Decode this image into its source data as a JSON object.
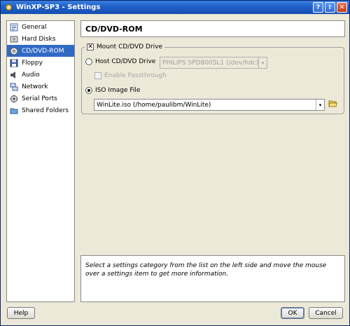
{
  "window": {
    "title": "WinXP-SP3 - Settings",
    "buttons": {
      "help": "?",
      "maximize": "⇧",
      "close": "✕"
    }
  },
  "sidebar": {
    "items": [
      {
        "label": "General",
        "icon": "general-icon",
        "selected": false
      },
      {
        "label": "Hard Disks",
        "icon": "hard-disk-icon",
        "selected": false
      },
      {
        "label": "CD/DVD-ROM",
        "icon": "cd-dvd-icon",
        "selected": true
      },
      {
        "label": "Floppy",
        "icon": "floppy-icon",
        "selected": false
      },
      {
        "label": "Audio",
        "icon": "audio-icon",
        "selected": false
      },
      {
        "label": "Network",
        "icon": "network-icon",
        "selected": false
      },
      {
        "label": "Serial Ports",
        "icon": "serial-ports-icon",
        "selected": false
      },
      {
        "label": "Shared Folders",
        "icon": "shared-folders-icon",
        "selected": false
      }
    ]
  },
  "main": {
    "heading": "CD/DVD-ROM",
    "mount": {
      "label": "Mount CD/DVD Drive",
      "checked": true
    },
    "host_drive": {
      "label": "Host CD/DVD Drive",
      "selected": false,
      "combo_value": "PHILIPS SPD8005L1 (/dev/hdc)"
    },
    "passthrough": {
      "label": "Enable Passthrough",
      "checked": false,
      "enabled": false
    },
    "iso_image": {
      "label": "ISO Image File",
      "selected": true,
      "combo_value": "WinLite.iso (/home/paulibm/WinLite)"
    }
  },
  "info": {
    "text": "Select a settings category from the list on the left side and move the mouse over a settings item to get more information."
  },
  "footer": {
    "help": "Help",
    "ok": "OK",
    "cancel": "Cancel"
  },
  "colors": {
    "selection": "#316ac5",
    "titlebar": "#1f5fc8"
  }
}
